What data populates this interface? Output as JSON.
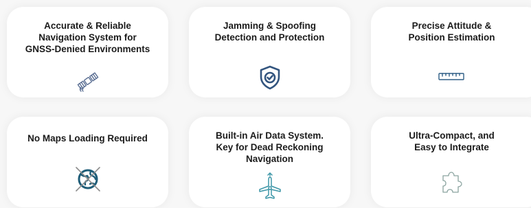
{
  "features": {
    "items": [
      {
        "title": "Accurate & Reliable\nNavigation System for\nGNSS-Denied Environments",
        "icon": "satellite-icon",
        "icon_color": "#5b6f93"
      },
      {
        "title": "Jamming & Spoofing\nDetection and Protection",
        "icon": "shield-check-icon",
        "icon_color": "#33557f"
      },
      {
        "title": "Precise Attitude &\nPosition Estimation",
        "icon": "ruler-icon",
        "icon_color": "#2f5f86"
      },
      {
        "title": "No Maps Loading Required",
        "icon": "no-map-globe-icon",
        "icon_color": "#1f5d78"
      },
      {
        "title": "Built-in Air Data System.\nKey for Dead Reckoning\nNavigation",
        "icon": "plane-direction-icon",
        "icon_color": "#3d96a7"
      },
      {
        "title": "Ultra-Compact, and\nEasy to Integrate",
        "icon": "puzzle-icon",
        "icon_color": "#8aa39f"
      }
    ]
  }
}
